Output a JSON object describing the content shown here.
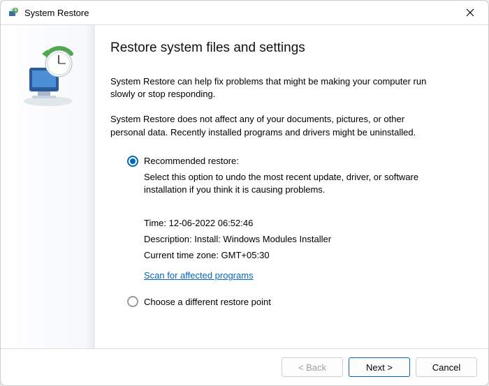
{
  "window": {
    "title": "System Restore"
  },
  "main": {
    "heading": "Restore system files and settings",
    "paragraph1": "System Restore can help fix problems that might be making your computer run slowly or stop responding.",
    "paragraph2": "System Restore does not affect any of your documents, pictures, or other personal data. Recently installed programs and drivers might be uninstalled."
  },
  "options": {
    "recommended": {
      "label": "Recommended restore:",
      "description": "Select this option to undo the most recent update, driver, or software installation if you think it is causing problems.",
      "time": "Time: 12-06-2022 06:52:46",
      "desc_line": "Description: Install: Windows Modules Installer",
      "timezone": "Current time zone: GMT+05:30",
      "scan_link": "Scan for affected programs"
    },
    "different": {
      "label": "Choose a different restore point"
    }
  },
  "footer": {
    "back": "< Back",
    "next": "Next >",
    "cancel": "Cancel"
  }
}
